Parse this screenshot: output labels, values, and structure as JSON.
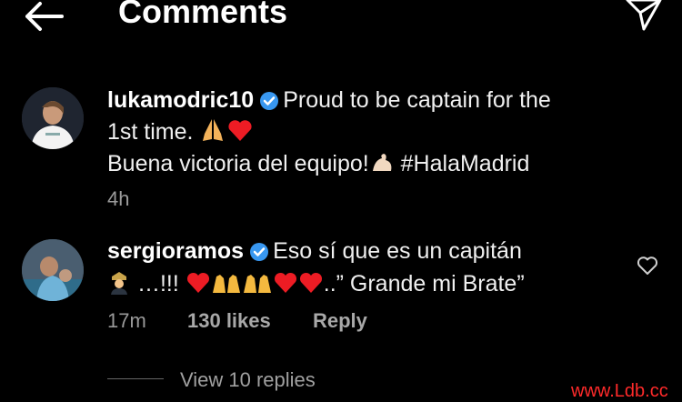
{
  "header": {
    "title": "Comments",
    "back_icon": "arrow-left-icon",
    "send_icon": "paper-plane-icon"
  },
  "comments": [
    {
      "username": "lukamodric10",
      "text_line1": "Proud to be captain for the",
      "text_line2": "1st time.",
      "text_line3": "Buena victoria del equipo!",
      "hashtag": "#HalaMadrid",
      "time": "4h"
    },
    {
      "username": "sergioramos",
      "text_line1": "Eso sí que es un capitán",
      "text_line2a": "…!!!",
      "text_line2b": "..” Grande mi Brate”",
      "time": "17m",
      "likes": "130 likes",
      "reply": "Reply",
      "view_replies": "View 10 replies"
    }
  ],
  "watermark": "www.Ldb.cc",
  "colors": {
    "background": "#000000",
    "verified": "#3897f0",
    "heart": "#ed1c24",
    "meta": "#9a9a9a"
  }
}
